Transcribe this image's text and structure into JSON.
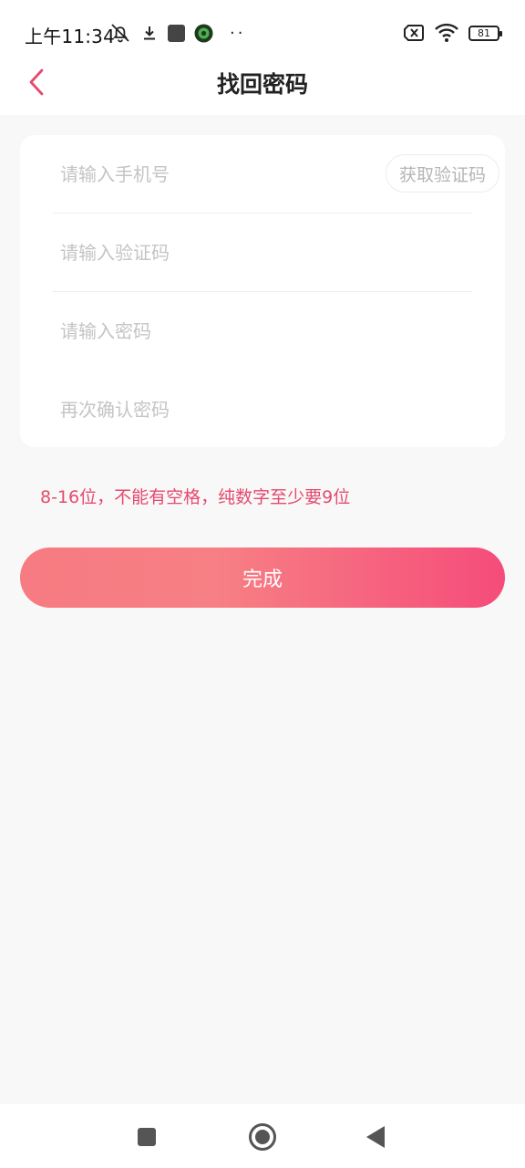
{
  "status_bar": {
    "time": "上午11:34",
    "battery": "81",
    "dots": "··",
    "icons_left": [
      "bell-off-icon",
      "download-icon",
      "app-square-icon",
      "app-badge-icon"
    ],
    "icons_right": [
      "sim-x-icon",
      "wifi-icon",
      "battery-icon"
    ]
  },
  "header": {
    "title": "找回密码",
    "back_icon": "chevron-left-icon"
  },
  "form": {
    "phone_placeholder": "请输入手机号",
    "get_code_label": "获取验证码",
    "code_placeholder": "请输入验证码",
    "password_placeholder": "请输入密码",
    "confirm_placeholder": "再次确认密码"
  },
  "hint": "8-16位，不能有空格，纯数字至少要9位",
  "submit_label": "完成",
  "nav_bar": {
    "icons": [
      "square-icon",
      "circle-home-icon",
      "triangle-back-icon"
    ]
  },
  "colors": {
    "accent": "#e54a6e",
    "gradient_start": "#f67b82",
    "gradient_end": "#f54c7a",
    "background": "#f8f8f8",
    "card": "#ffffff",
    "placeholder": "#c4c4c4"
  }
}
